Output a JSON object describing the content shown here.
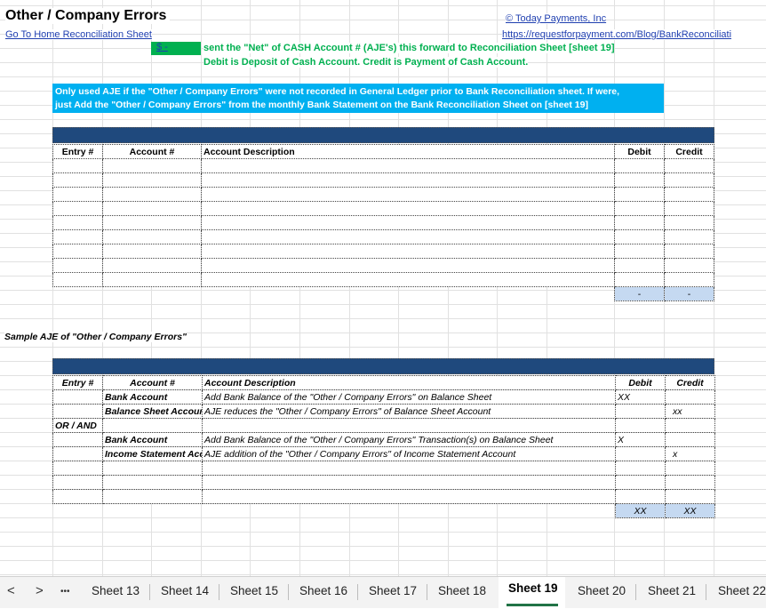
{
  "sheet": {
    "title": "Other / Company Errors",
    "home_link": "Go To Home Reconciliation Sheet",
    "company_link": "© Today Payments, Inc",
    "url_link": "https://requestforpayment.com/Blog/BankReconciliati",
    "net_cell": "$      -",
    "net_note_1": "sent the \"Net\" of CASH Account # (AJE's) this forward to Reconciliation Sheet [sheet 19]",
    "net_note_2": "Debit is Deposit of Cash Account.  Credit is Payment of Cash Account.",
    "info_line_1": "Only used AJE if the \"Other / Company Errors\" were not recorded in General Ledger prior to Bank Reconciliation sheet.  If were,",
    "info_line_2": "just Add the \"Other / Company Errors\" from the monthly Bank Statement on the Bank Reconciliation Sheet on [sheet 19]"
  },
  "table1": {
    "headers": [
      "Entry #",
      "Account #",
      "Account Description",
      "Debit",
      "Credit"
    ],
    "total_debit": "-",
    "total_credit": "-"
  },
  "sample": {
    "label": "Sample AJE of \"Other / Company Errors\"",
    "headers": [
      "Entry #",
      "Account #",
      "Account Description",
      "Debit",
      "Credit"
    ],
    "rows": [
      {
        "entry": "",
        "account": "Bank Account",
        "desc": "Add Bank Balance of the \"Other / Company Errors\" on Balance Sheet",
        "debit": "XX",
        "credit": ""
      },
      {
        "entry": "",
        "account": "Balance Sheet Account",
        "desc": "AJE reduces the \"Other / Company Errors\" of Balance Sheet Account",
        "debit": "",
        "credit": "xx"
      },
      {
        "entry": "OR / AND",
        "account": "",
        "desc": "",
        "debit": "",
        "credit": ""
      },
      {
        "entry": "",
        "account": "Bank Account",
        "desc": "Add Bank Balance of the \"Other / Company Errors\" Transaction(s) on Balance Sheet",
        "debit": "X",
        "credit": ""
      },
      {
        "entry": "",
        "account": "Income Statement Account",
        "desc": "AJE addition of the \"Other / Company Errors\" of Income Statement Account",
        "debit": "",
        "credit": "x"
      }
    ],
    "total_debit": "XX",
    "total_credit": "XX"
  },
  "tabs": {
    "prev": "<",
    "next": ">",
    "more": "•••",
    "items": [
      "Sheet 13",
      "Sheet 14",
      "Sheet 15",
      "Sheet 16",
      "Sheet 17",
      "Sheet 18",
      "Sheet 19",
      "Sheet 20",
      "Sheet 21",
      "Sheet 22"
    ],
    "active": "Sheet 19"
  },
  "colors": {
    "header_bar": "#1f497d",
    "info_box": "#00b0f0",
    "green_cell": "#00b050",
    "total_cell": "#c5d9f1",
    "active_tab": "#217346"
  }
}
